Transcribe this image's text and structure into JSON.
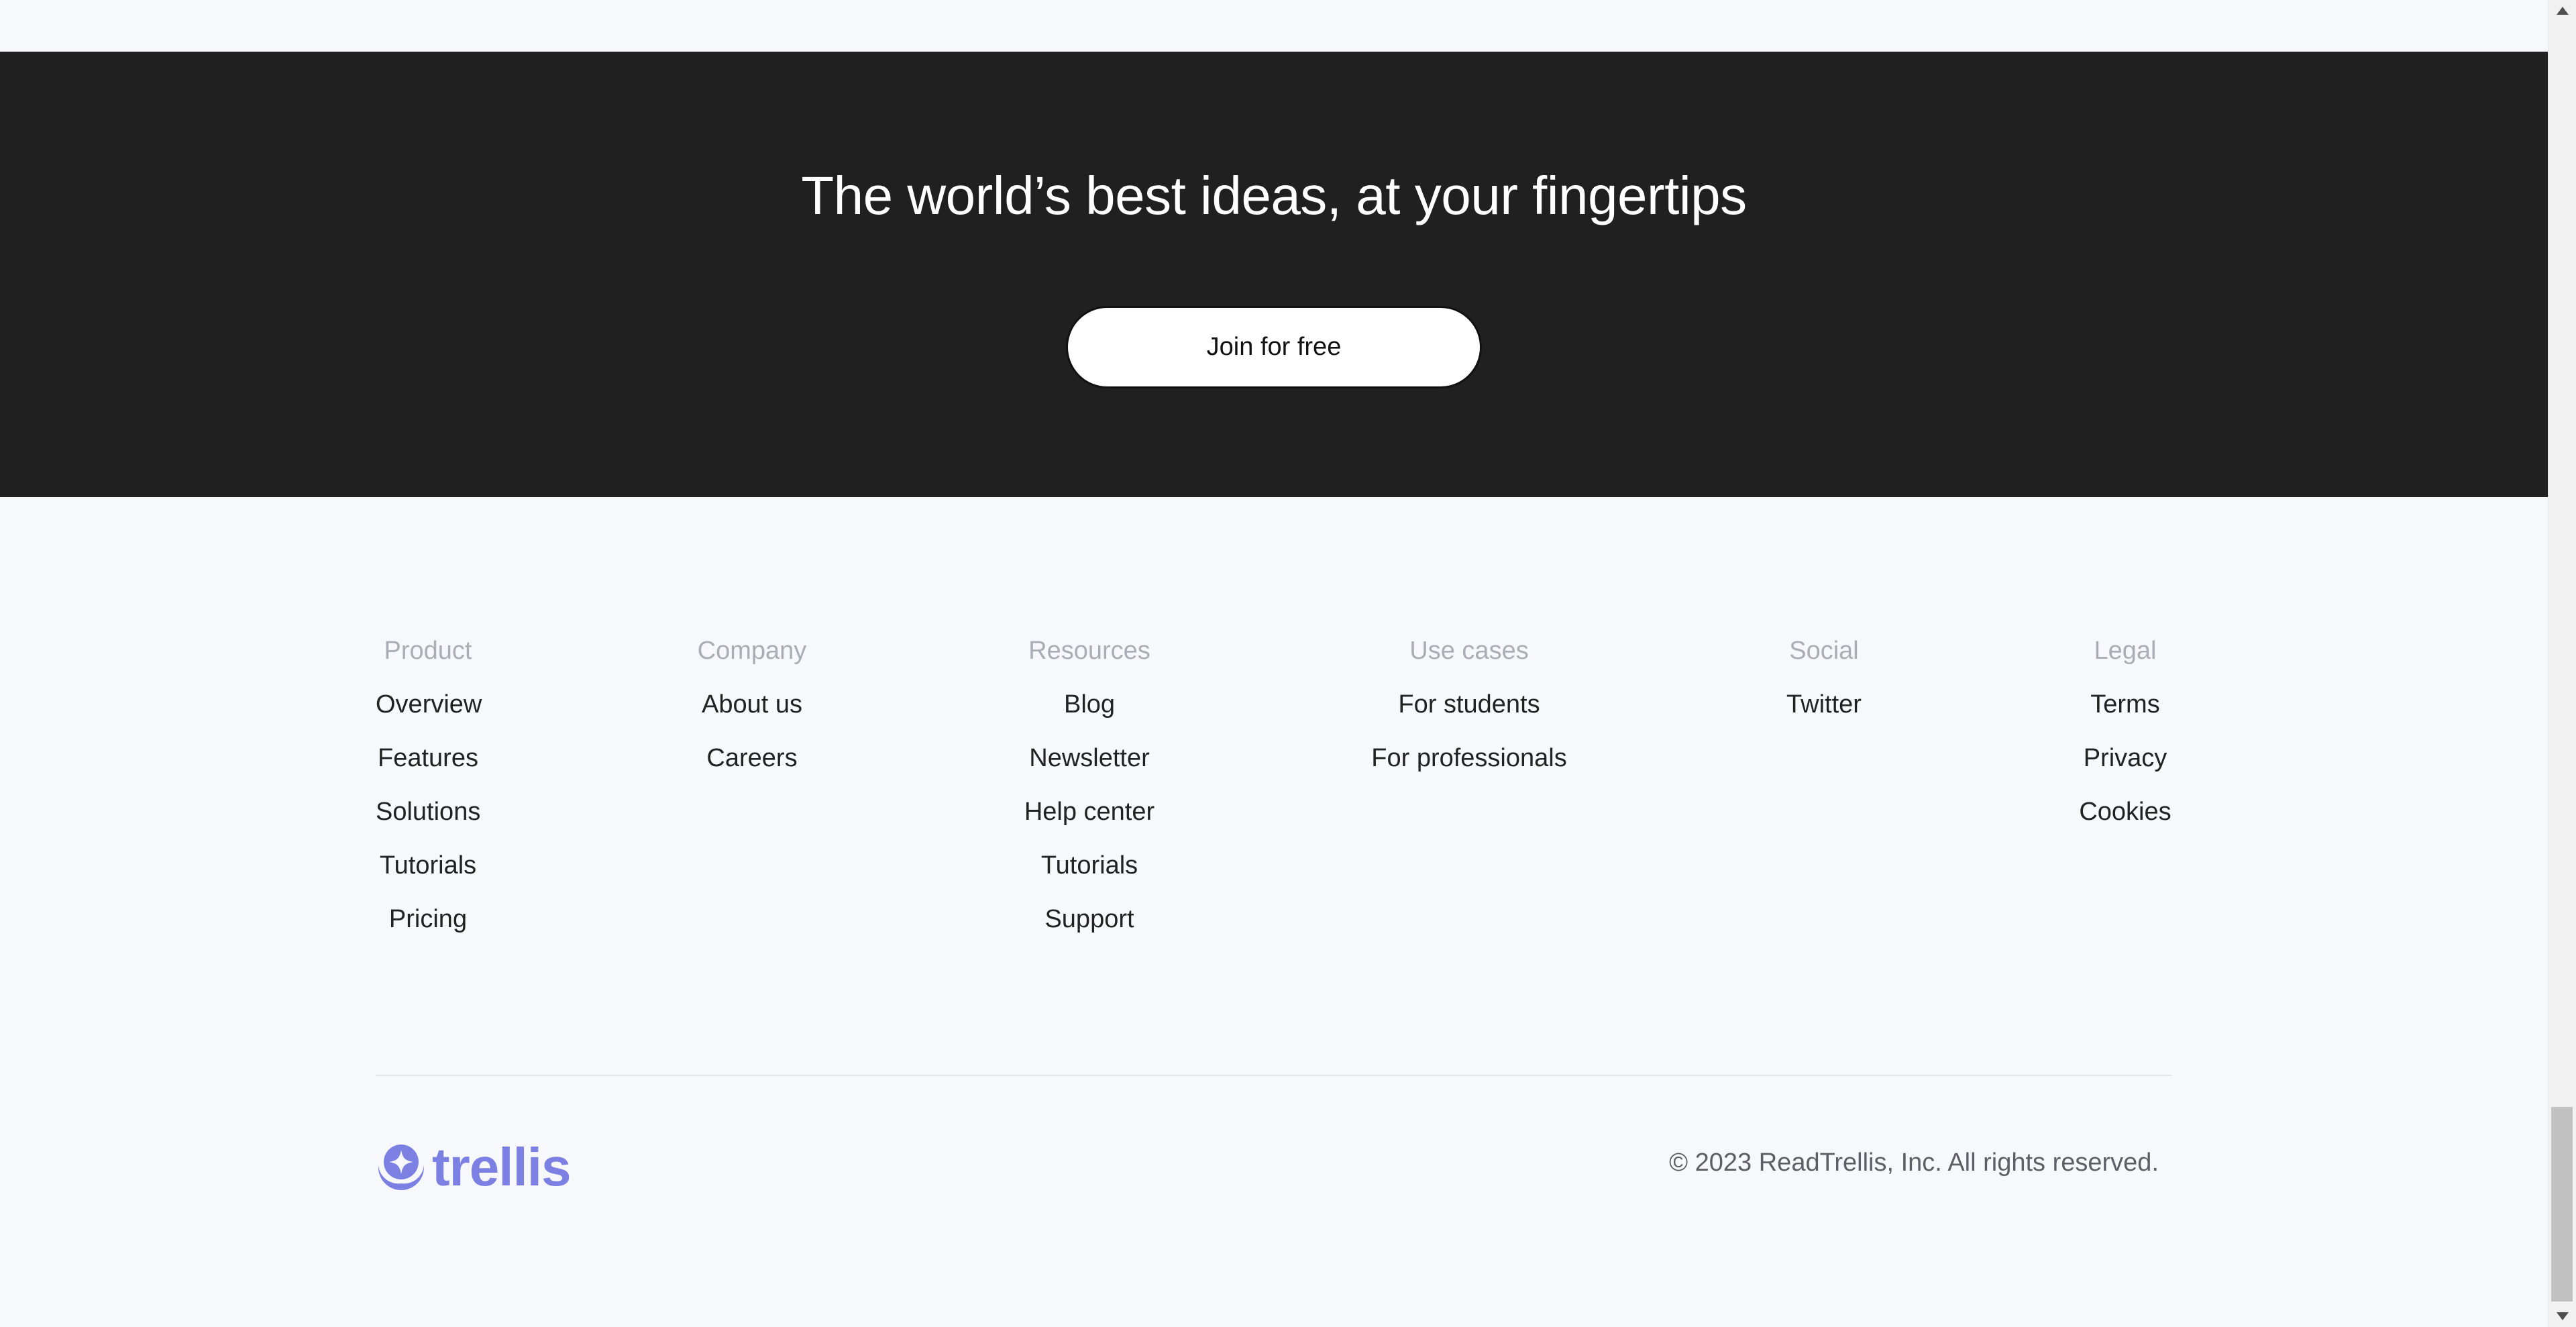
{
  "cta": {
    "title": "The world’s best ideas, at your fingertips",
    "button_label": "Join for free"
  },
  "footer": {
    "columns": [
      {
        "heading": "Product",
        "links": [
          "Overview",
          "Features",
          "Solutions",
          "Tutorials",
          "Pricing"
        ]
      },
      {
        "heading": "Company",
        "links": [
          "About us",
          "Careers"
        ]
      },
      {
        "heading": "Resources",
        "links": [
          "Blog",
          "Newsletter",
          "Help center",
          "Tutorials",
          "Support"
        ]
      },
      {
        "heading": "Use cases",
        "links": [
          "For students",
          "For professionals"
        ]
      },
      {
        "heading": "Social",
        "links": [
          "Twitter"
        ]
      },
      {
        "heading": "Legal",
        "links": [
          "Terms",
          "Privacy",
          "Cookies"
        ]
      }
    ],
    "logo": {
      "icon": "trellis-logo-icon",
      "wordmark": "trellis",
      "color": "#7c80e3"
    },
    "copyright": "© 2023 ReadTrellis, Inc. All rights reserved."
  },
  "colors": {
    "cta_background": "#202020",
    "page_background": "#f7f8fb",
    "heading_muted": "#a9adb5",
    "link_text": "#222222"
  }
}
